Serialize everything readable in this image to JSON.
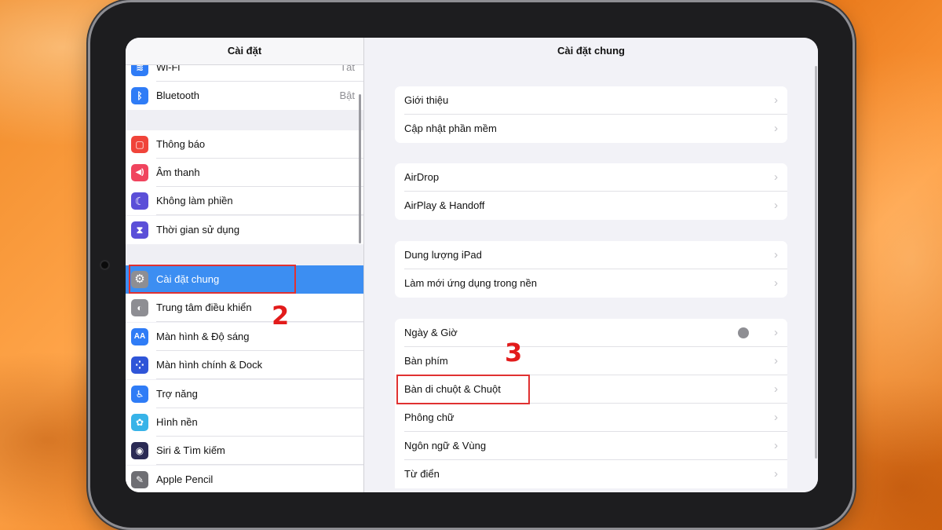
{
  "left_panel": {
    "title": "Cài đặt",
    "items": [
      {
        "label": "Wi-Fi",
        "value": "Tắt",
        "icon": "wifi-icon",
        "icon_color": "#2f7cf6",
        "glyph": "≋"
      },
      {
        "label": "Bluetooth",
        "value": "Bật",
        "icon": "bluetooth-icon",
        "icon_color": "#2f7cf6",
        "glyph": "ᛒ"
      },
      {
        "label": "Thông báo",
        "icon": "notifications-icon",
        "icon_color": "#f0443a",
        "glyph": "▢"
      },
      {
        "label": "Âm thanh",
        "icon": "sound-icon",
        "icon_color": "#f0445e",
        "glyph": "◀)"
      },
      {
        "label": "Không làm phiền",
        "icon": "do-not-disturb-icon",
        "icon_color": "#5b4fd8",
        "glyph": "☾"
      },
      {
        "label": "Thời gian sử dụng",
        "icon": "screen-time-icon",
        "icon_color": "#5b4fd8",
        "glyph": "⧗"
      },
      {
        "label": "Cài đặt chung",
        "icon": "gear-icon",
        "icon_color": "#8e8e93",
        "glyph": "⚙"
      },
      {
        "label": "Trung tâm điều khiển",
        "icon": "control-center-icon",
        "icon_color": "#8e8e93",
        "glyph": "◐"
      },
      {
        "label": "Màn hình & Độ sáng",
        "icon": "display-brightness-icon",
        "icon_color": "#2f7cf6",
        "glyph": "AA"
      },
      {
        "label": "Màn hình chính & Dock",
        "icon": "home-screen-icon",
        "icon_color": "#2f55d8",
        "glyph": "⁘"
      },
      {
        "label": "Trợ năng",
        "icon": "accessibility-icon",
        "icon_color": "#2f7cf6",
        "glyph": "♿"
      },
      {
        "label": "Hình nền",
        "icon": "wallpaper-icon",
        "icon_color": "#37b3e8",
        "glyph": "✿"
      },
      {
        "label": "Siri & Tìm kiếm",
        "icon": "siri-icon",
        "icon_color": "#2b2b55",
        "glyph": "◉"
      },
      {
        "label": "Apple Pencil",
        "icon": "apple-pencil-icon",
        "icon_color": "#6e6e73",
        "glyph": "✎"
      }
    ]
  },
  "right_panel": {
    "title": "Cài đặt chung",
    "groups": [
      [
        "Giới thiệu",
        "Cập nhật phần mềm"
      ],
      [
        "AirDrop",
        "AirPlay & Handoff"
      ],
      [
        "Dung lượng iPad",
        "Làm mới ứng dụng trong nền"
      ],
      [
        "Ngày & Giờ",
        "Bàn phím",
        "Bàn di chuột & Chuột",
        "Phông chữ",
        "Ngôn ngữ & Vùng",
        "Từ điển"
      ]
    ],
    "chevron": "›"
  },
  "annotations": {
    "step2": "2",
    "step3": "3",
    "highlight_color": "#e03131"
  }
}
